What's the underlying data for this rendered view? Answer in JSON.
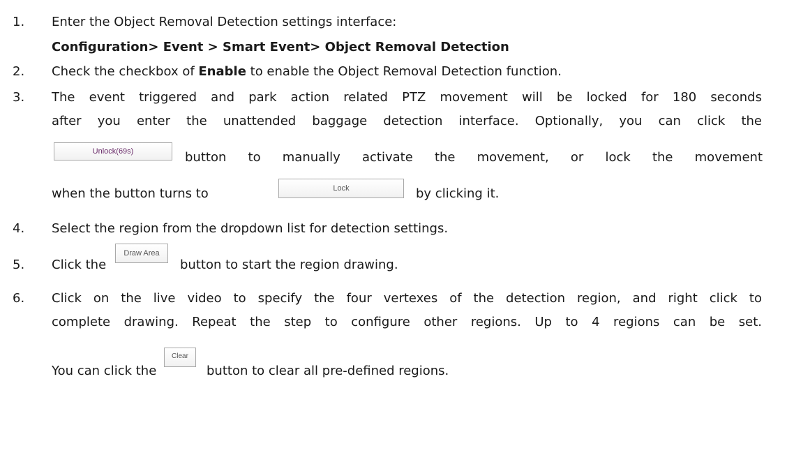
{
  "steps": [
    {
      "num": "1.",
      "text": "Enter the Object Removal Detection settings interface:"
    },
    {
      "path": "Configuration> Event > Smart Event> Object Removal Detection"
    },
    {
      "num": "2.",
      "pre": "Check the checkbox of ",
      "bold": "Enable",
      "post": " to enable the Object Removal Detection function."
    },
    {
      "num": "3.",
      "line1": "The event triggered and park action related PTZ movement will be locked for 180 seconds",
      "line2": "after you enter the unattended baggage detection interface. Optionally, you can click the",
      "line3": "button to manually activate the movement, or lock the movement",
      "line4_pre": "when the button turns to",
      "line4_post": "by clicking it."
    },
    {
      "num": "4.",
      "text": "Select the region from the dropdown list for detection settings."
    },
    {
      "num": "5.",
      "pre": "Click the",
      "post": "button to start the region drawing."
    },
    {
      "num": "6.",
      "line1": "Click on the live video to specify the four vertexes of the detection region, and right click to",
      "line2": "complete drawing. Repeat the step to configure other regions. Up to 4 regions can be set.",
      "line3_pre": "You can click the",
      "line3_post": "button to clear all pre-defined regions."
    }
  ],
  "buttons": {
    "unlock": "Unlock(69s)",
    "lock": "Lock",
    "draw_area": "Draw Area",
    "clear": "Clear"
  },
  "colors": {
    "unlock_text": "#6a2c6a"
  }
}
